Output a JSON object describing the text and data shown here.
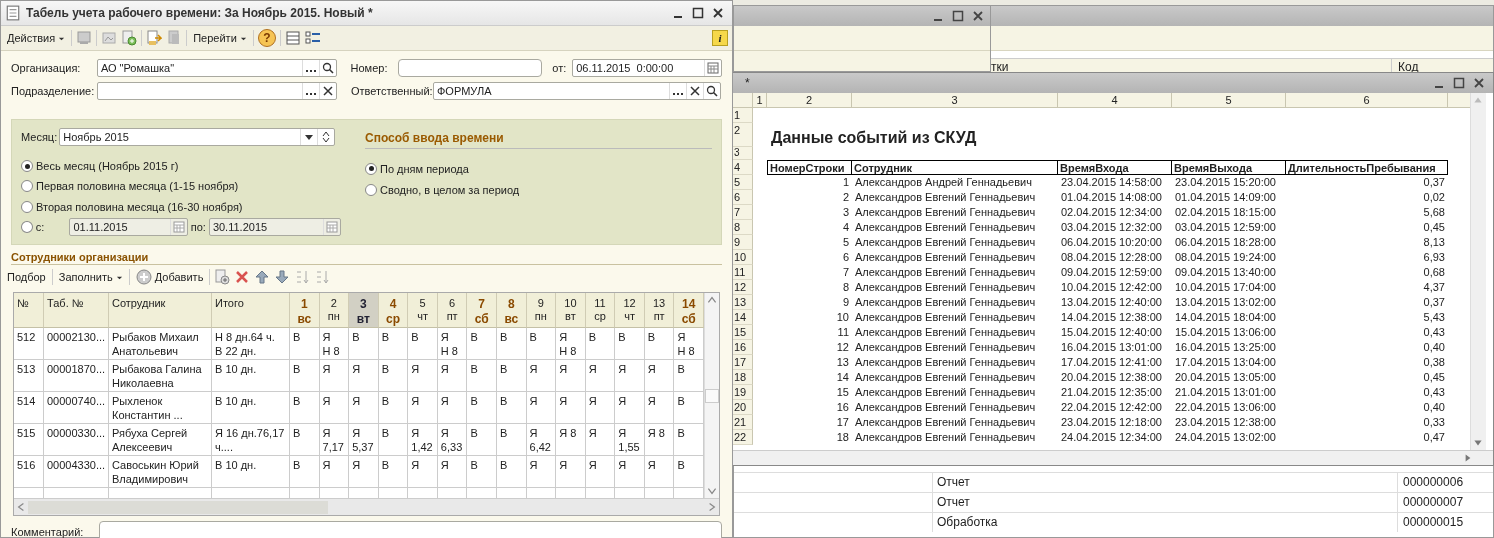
{
  "timesheet_window": {
    "title": "Табель учета рабочего времени: За Ноябрь 2015. Новый *",
    "actions_menu": "Действия",
    "goto_menu": "Перейти",
    "help": "?",
    "info": "i"
  },
  "form": {
    "organization": {
      "label": "Организация:",
      "value": "АО \"Ромашка\""
    },
    "number": {
      "label": "Номер:"
    },
    "date": {
      "label": "от:",
      "value": "06.11.2015  0:00:00"
    },
    "department": {
      "label": "Подразделение:"
    },
    "responsible": {
      "label": "Ответственный:",
      "value": "ФОРМУЛА"
    }
  },
  "period": {
    "month_label": "Месяц:",
    "month": "Ноябрь 2015",
    "options": [
      {
        "label": "Весь месяц (Ноябрь 2015 г)",
        "selected": true
      },
      {
        "label": "Первая половина месяца (1-15 ноября)",
        "selected": false
      },
      {
        "label": "Вторая половина месяца (16-30 ноября)",
        "selected": false
      },
      {
        "label": "с:",
        "selected": false
      }
    ],
    "from": "01.11.2015",
    "to_label": "по:",
    "to": "30.11.2015"
  },
  "input_mode": {
    "title": "Способ ввода времени",
    "options": [
      {
        "label": "По дням периода",
        "selected": true
      },
      {
        "label": "Сводно, в целом за период",
        "selected": false
      }
    ]
  },
  "employees": {
    "title": "Сотрудники организации",
    "pick": "Подбор",
    "fill": "Заполнить",
    "add": "Добавить",
    "columns": [
      "№",
      "Таб. №",
      "Сотрудник",
      "Итого"
    ],
    "days": [
      {
        "day": "1",
        "weekday": "вс",
        "holiday": true,
        "selected": false
      },
      {
        "day": "2",
        "weekday": "пн",
        "holiday": false,
        "selected": false
      },
      {
        "day": "3",
        "weekday": "вт",
        "holiday": false,
        "selected": true
      },
      {
        "day": "4",
        "weekday": "ср",
        "holiday": true,
        "selected": false
      },
      {
        "day": "5",
        "weekday": "чт",
        "holiday": false,
        "selected": false
      },
      {
        "day": "6",
        "weekday": "пт",
        "holiday": false,
        "selected": false
      },
      {
        "day": "7",
        "weekday": "сб",
        "holiday": true,
        "selected": false
      },
      {
        "day": "8",
        "weekday": "вс",
        "holiday": true,
        "selected": false
      },
      {
        "day": "9",
        "weekday": "пн",
        "holiday": false,
        "selected": false
      },
      {
        "day": "10",
        "weekday": "вт",
        "holiday": false,
        "selected": false
      },
      {
        "day": "11",
        "weekday": "ср",
        "holiday": false,
        "selected": false
      },
      {
        "day": "12",
        "weekday": "чт",
        "holiday": false,
        "selected": false
      },
      {
        "day": "13",
        "weekday": "пт",
        "holiday": false,
        "selected": false
      },
      {
        "day": "14",
        "weekday": "сб",
        "holiday": true,
        "selected": false
      }
    ],
    "rows": [
      {
        "cells": [
          "512",
          "00002130...",
          "Рыбаков Михаил\nАнатольевич",
          "Н 8 дн.64 ч.\nВ 22 дн."
        ],
        "days": [
          "В",
          "Я\nН 8",
          "В",
          "В",
          "В",
          "Я\nН 8",
          "В",
          "В",
          "В",
          "Я\nН 8",
          "В",
          "В",
          "В",
          "Я\nН 8"
        ]
      },
      {
        "cells": [
          "513",
          "00001870...",
          "Рыбакова Галина\nНиколаевна",
          "В 10 дн."
        ],
        "days": [
          "В",
          "Я",
          "Я",
          "В",
          "Я",
          "Я",
          "В",
          "В",
          "Я",
          "Я",
          "Я",
          "Я",
          "Я",
          "В"
        ]
      },
      {
        "cells": [
          "514",
          "00000740...",
          "Рыхленок\nКонстантин ...",
          "В 10 дн."
        ],
        "days": [
          "В",
          "Я",
          "Я",
          "В",
          "Я",
          "Я",
          "В",
          "В",
          "Я",
          "Я",
          "Я",
          "Я",
          "Я",
          "В"
        ]
      },
      {
        "cells": [
          "515",
          "00000330...",
          "Рябуха Сергей\nАлексеевич",
          "Я 16 дн.76,17\nч...."
        ],
        "days": [
          "В",
          "Я\n7,17",
          "Я\n5,37",
          "В",
          "Я\n1,42",
          "Я\n6,33",
          "В",
          "В",
          "Я\n6,42",
          "Я 8",
          "Я",
          "Я\n1,55",
          "Я 8",
          "В"
        ]
      },
      {
        "cells": [
          "516",
          "00004330...",
          "Савоськин Юрий\nВладимирович",
          "В 10 дн."
        ],
        "days": [
          "В",
          "Я",
          "Я",
          "В",
          "Я",
          "Я",
          "В",
          "В",
          "Я",
          "Я",
          "Я",
          "Я",
          "Я",
          "В"
        ]
      }
    ]
  },
  "comment_label": "Комментарий:",
  "list_window": {
    "headers": [
      "тки",
      "Код"
    ],
    "rows": [
      {
        "type": "Отчет",
        "code": "000000006"
      },
      {
        "type": "Отчет",
        "code": "000000007"
      },
      {
        "type": "Обработка",
        "code": "000000015"
      }
    ]
  },
  "report_window": {
    "title": "*",
    "column_numbers": [
      "1",
      "2",
      "3",
      "4",
      "5",
      "6"
    ],
    "row_numbers": [
      "1",
      "2",
      "3",
      "4",
      "5",
      "6",
      "7",
      "8",
      "9",
      "10",
      "11",
      "12",
      "13",
      "14",
      "15",
      "16",
      "17",
      "18",
      "19",
      "20",
      "21",
      "22"
    ],
    "heading": "Данные событий из СКУД",
    "headers": [
      "НомерСтроки",
      "Сотрудник",
      "ВремяВхода",
      "ВремяВыхода",
      "ДлительностьПребывания"
    ],
    "rows": [
      [
        "1",
        "Александров Андрей Геннадьевич",
        "23.04.2015 14:58:00",
        "23.04.2015 15:20:00",
        "0,37"
      ],
      [
        "2",
        "Александров Евгений Геннадьевич",
        "01.04.2015 14:08:00",
        "01.04.2015 14:09:00",
        "0,02"
      ],
      [
        "3",
        "Александров Евгений Геннадьевич",
        "02.04.2015 12:34:00",
        "02.04.2015 18:15:00",
        "5,68"
      ],
      [
        "4",
        "Александров Евгений Геннадьевич",
        "03.04.2015 12:32:00",
        "03.04.2015 12:59:00",
        "0,45"
      ],
      [
        "5",
        "Александров Евгений Геннадьевич",
        "06.04.2015 10:20:00",
        "06.04.2015 18:28:00",
        "8,13"
      ],
      [
        "6",
        "Александров Евгений Геннадьевич",
        "08.04.2015 12:28:00",
        "08.04.2015 19:24:00",
        "6,93"
      ],
      [
        "7",
        "Александров Евгений Геннадьевич",
        "09.04.2015 12:59:00",
        "09.04.2015 13:40:00",
        "0,68"
      ],
      [
        "8",
        "Александров Евгений Геннадьевич",
        "10.04.2015 12:42:00",
        "10.04.2015 17:04:00",
        "4,37"
      ],
      [
        "9",
        "Александров Евгений Геннадьевич",
        "13.04.2015 12:40:00",
        "13.04.2015 13:02:00",
        "0,37"
      ],
      [
        "10",
        "Александров Евгений Геннадьевич",
        "14.04.2015 12:38:00",
        "14.04.2015 18:04:00",
        "5,43"
      ],
      [
        "11",
        "Александров Евгений Геннадьевич",
        "15.04.2015 12:40:00",
        "15.04.2015 13:06:00",
        "0,43"
      ],
      [
        "12",
        "Александров Евгений Геннадьевич",
        "16.04.2015 13:01:00",
        "16.04.2015 13:25:00",
        "0,40"
      ],
      [
        "13",
        "Александров Евгений Геннадьевич",
        "17.04.2015 12:41:00",
        "17.04.2015 13:04:00",
        "0,38"
      ],
      [
        "14",
        "Александров Евгений Геннадьевич",
        "20.04.2015 12:38:00",
        "20.04.2015 13:05:00",
        "0,45"
      ],
      [
        "15",
        "Александров Евгений Геннадьевич",
        "21.04.2015 12:35:00",
        "21.04.2015 13:01:00",
        "0,43"
      ],
      [
        "16",
        "Александров Евгений Геннадьевич",
        "22.04.2015 12:42:00",
        "22.04.2015 13:06:00",
        "0,40"
      ],
      [
        "17",
        "Александров Евгений Геннадьевич",
        "23.04.2015 12:18:00",
        "23.04.2015 12:38:00",
        "0,33"
      ],
      [
        "18",
        "Александров Евгений Геннадьевич",
        "24.04.2015 12:34:00",
        "24.04.2015 13:02:00",
        "0,47"
      ]
    ]
  }
}
